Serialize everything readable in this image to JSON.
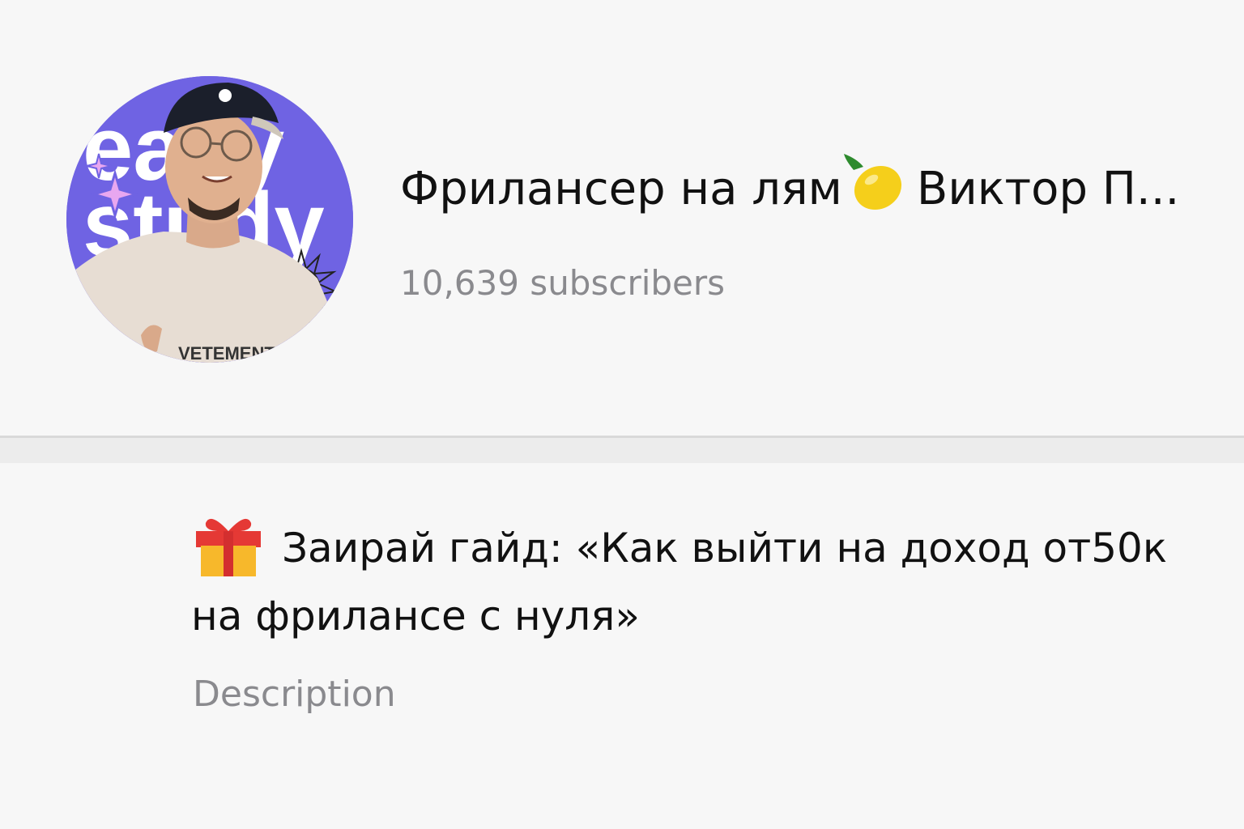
{
  "channel": {
    "name_part1": "Фрилансер на лям",
    "name_emoji_icon": "lemon-icon",
    "name_part2": "Виктор П...",
    "subscribers": "10,639 subscribers",
    "avatar_text_line1": "easy",
    "avatar_text_line2": "study",
    "avatar_shirt_text": "VETEMENTS",
    "avatar_bg_color": "#6f63e3"
  },
  "description": {
    "emoji_icon": "gift-icon",
    "text": "Заирай гайд: «Как выйти на доход от50к на фрилансе с нуля»",
    "label": "Description"
  },
  "colors": {
    "background": "#f6f6f6",
    "primary_text": "#111111",
    "secondary_text": "#8a8a8e",
    "divider": "#ececec"
  }
}
